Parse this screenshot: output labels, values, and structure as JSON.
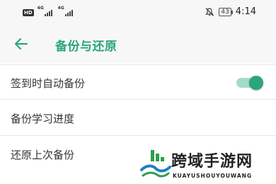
{
  "status_bar": {
    "hd_label": "HD",
    "signal1_label": "4G",
    "signal2_label": "4G",
    "battery_level": "43",
    "time": "4:14",
    "icons": [
      "mute-icon",
      "battery-icon"
    ]
  },
  "header": {
    "title": "备份与还原",
    "back_icon": "arrow-left-icon",
    "accent_color": "#2aa57e"
  },
  "settings": {
    "auto_backup": {
      "label": "签到时自动备份",
      "enabled": true
    },
    "backup_progress": {
      "label": "备份学习进度"
    },
    "restore_backup": {
      "label": "还原上次备份"
    }
  },
  "watermark": {
    "cn_text": "跨域手游网",
    "en_text": "KUAYUSHOUYOUWANG"
  }
}
